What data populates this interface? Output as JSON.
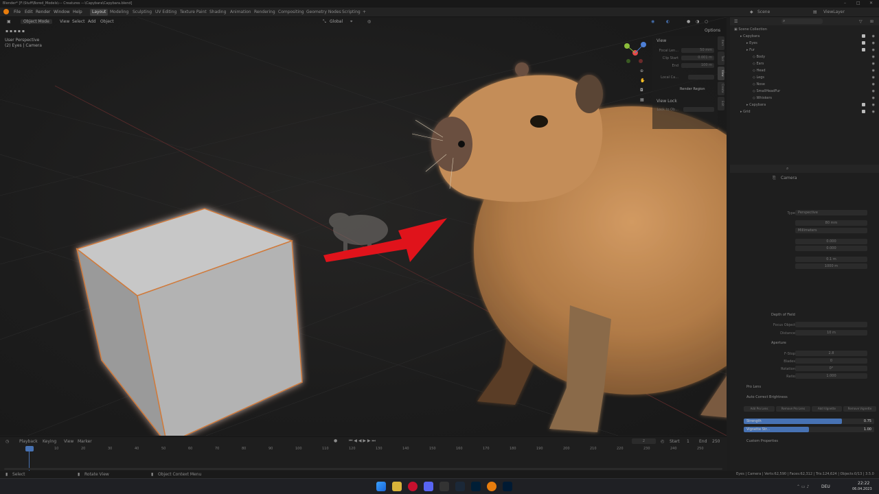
{
  "window": {
    "title": "Blender* [F:\\Stuff\\Bored_Models\\--- Creatures ---\\Capybara\\Capybara.blend]"
  },
  "menu": [
    "File",
    "Edit",
    "Render",
    "Window",
    "Help"
  ],
  "workspaces": [
    "Layout",
    "Modeling",
    "Sculpting",
    "UV Editing",
    "Texture Paint",
    "Shading",
    "Animation",
    "Rendering",
    "Compositing",
    "Geometry Nodes",
    "Scripting",
    "+"
  ],
  "scene": {
    "name": "Scene",
    "view_layer": "ViewLayer"
  },
  "viewport": {
    "mode": "Object Mode",
    "menus": [
      "View",
      "Select",
      "Add",
      "Object"
    ],
    "orientation": "Global",
    "options_label": "Options",
    "overlay_line1": "User Perspective",
    "overlay_line2": "(2) Eyes | Camera"
  },
  "npanel": {
    "section": "View",
    "rows": [
      {
        "label": "Focal Len...",
        "value": "50 mm"
      },
      {
        "label": "Clip Start",
        "value": "0.001 m"
      },
      {
        "label": "End",
        "value": "100 m"
      },
      {
        "label": "Local Ca...",
        "value": ""
      }
    ],
    "render_region": "Render Region",
    "view_lock": "View Lock",
    "lock_to_object": "Lock to Ob..."
  },
  "side_tabs": [
    "Item",
    "Tool",
    "View",
    "Create",
    "Edit"
  ],
  "outliner": {
    "root": "Scene Collection",
    "rows": [
      {
        "label": "Capybara",
        "indent": 1
      },
      {
        "label": "Eyes",
        "indent": 2
      },
      {
        "label": "Fur",
        "indent": 2
      },
      {
        "label": "Body",
        "indent": 3
      },
      {
        "label": "Ears",
        "indent": 3
      },
      {
        "label": "Head",
        "indent": 3
      },
      {
        "label": "Legs",
        "indent": 3
      },
      {
        "label": "Nose",
        "indent": 3
      },
      {
        "label": "SmallHeadFur",
        "indent": 3
      },
      {
        "label": "Whiskers",
        "indent": 3
      },
      {
        "label": "Capybara",
        "indent": 2
      },
      {
        "label": "Grid",
        "indent": 1
      }
    ]
  },
  "properties": {
    "object": "Camera",
    "lens_type": "Perspective",
    "focal_length": "80 mm",
    "lens_unit": "Millimeters",
    "shift_x": "0.000",
    "shift_y": "0.000",
    "clip_start": "0.1 m",
    "clip_end": "1000 m",
    "dof": "Depth of Field",
    "focus_object": "Focus Object",
    "distance_label": "Distance",
    "distance": "10 m",
    "aperture": "Aperture",
    "fstop_label": "F-Stop",
    "fstop": "2.8",
    "blades_label": "Blades",
    "blades": "0",
    "rotation_label": "Rotation",
    "rotation": "0°",
    "ratio_label": "Ratio",
    "ratio": "1.000",
    "pro_lens": "Pro Lens",
    "auto_correct": "Auto Correct Brightness",
    "btn_add": "Add Pro Lens",
    "btn_remove": "Remove Pro Lens",
    "btn_add_vig": "Add Vignette",
    "btn_remove_vig": "Remove Vignette",
    "strength_label": "Strength",
    "strength": "0.75",
    "vignette_label": "Vignette Str...",
    "vignette": "1.00",
    "custom": "Custom Properties"
  },
  "timeline": {
    "menus": [
      "Playback",
      "Keying",
      "View",
      "Marker"
    ],
    "current_frame": "2",
    "start_label": "Start",
    "start": "1",
    "end_label": "End",
    "end": "250",
    "ticks": [
      "0",
      "10",
      "20",
      "30",
      "40",
      "50",
      "60",
      "70",
      "80",
      "90",
      "100",
      "110",
      "120",
      "130",
      "140",
      "150",
      "160",
      "170",
      "180",
      "190",
      "200",
      "210",
      "220",
      "230",
      "240",
      "250"
    ]
  },
  "status": {
    "select": "Select",
    "rotate": "Rotate View",
    "context": "Object Context Menu",
    "stats": "Eyes | Camera | Verts:62,590 | Faces:62,312 | Tris:124,624 | Objects:0/13 | 3.5.0"
  },
  "taskbar": {
    "lang": "DEU",
    "time": "22:22",
    "date": "06.04.2023"
  },
  "colors": {
    "accent_red": "#e0131b",
    "blue_bar": "#4772b3",
    "fur": "#c08a55"
  }
}
